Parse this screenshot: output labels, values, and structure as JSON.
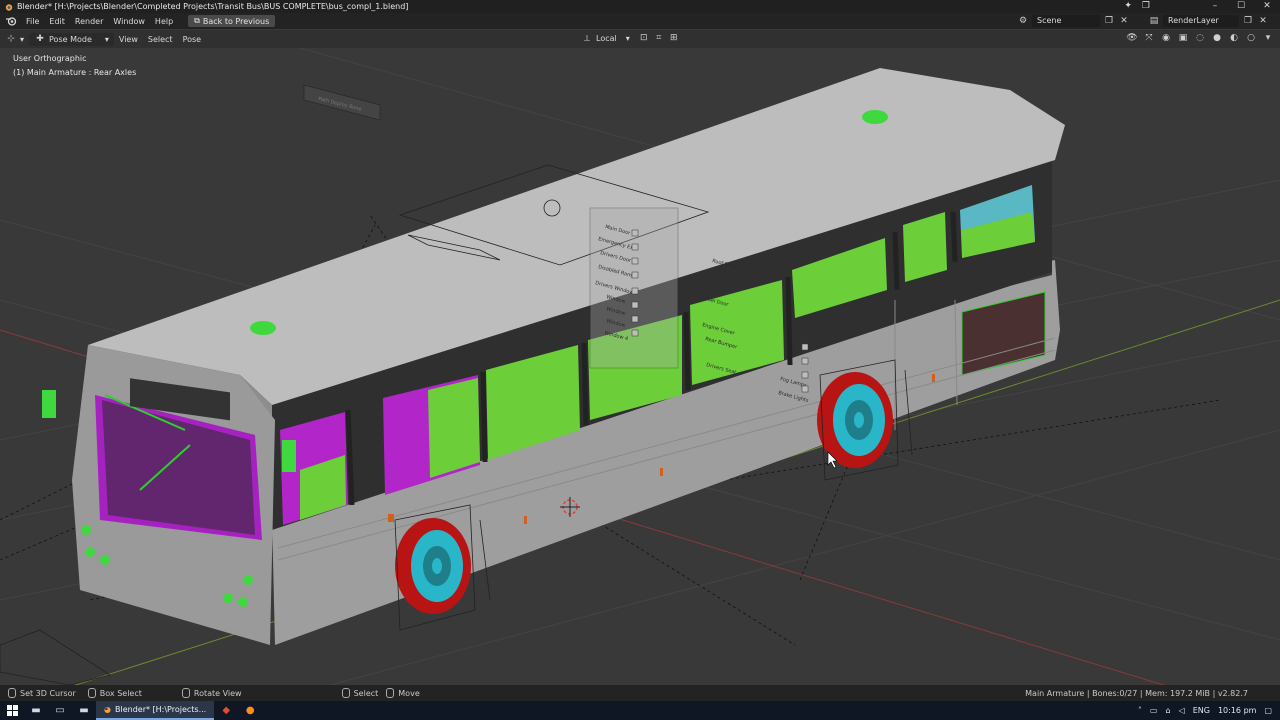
{
  "window": {
    "title": "Blender* [H:\\Projects\\Blender\\Completed Projects\\Transit Bus\\BUS COMPLETE\\bus_compl_1.blend]"
  },
  "menubar": {
    "items": [
      "File",
      "Edit",
      "Render",
      "Window",
      "Help"
    ],
    "back_button": "Back to Previous",
    "scene_name": "Scene",
    "render_layer": "RenderLayer"
  },
  "header3d": {
    "mode": "Pose Mode",
    "menus": [
      "View",
      "Select",
      "Pose"
    ],
    "transform_orientation": "Local"
  },
  "viewport": {
    "view_name": "User Orthographic",
    "active_object": "(1) Main Armature : Rear Axles",
    "bone_panel_labels": [
      "Main Door",
      "Emergency Exit",
      "Drivers Door",
      "Disabled Ramp",
      "Drivers Window",
      "Window",
      "Window",
      "Window",
      "Window 4"
    ],
    "bone_panel_labels_2": [
      "Roof Fans",
      "Fuel Door",
      "Engine Cover",
      "Rear Bumper",
      "Drivers Seat",
      "Fog Lamps",
      "Brake Lights"
    ],
    "top_bone_label": "Path Deploy Bone"
  },
  "statusbar": {
    "set_cursor": "Set 3D Cursor",
    "box_select": "Box Select",
    "rotate_view": "Rotate View",
    "select": "Select",
    "move": "Move",
    "stats": "Main Armature | Bones:0/27 | Mem: 197.2 MiB | v2.82.7"
  },
  "taskbar": {
    "active_app": "Blender* [H:\\Projects...",
    "language": "ENG",
    "time": "10:16 pm"
  },
  "colors": {
    "body_gray": "#a9a9a9",
    "roof_gray": "#c8c8c8",
    "seat_green": "#6ccf3a",
    "interior_magenta": "#b226c9",
    "tyre_red": "#c41616",
    "rim_cyan": "#29b6c8"
  }
}
